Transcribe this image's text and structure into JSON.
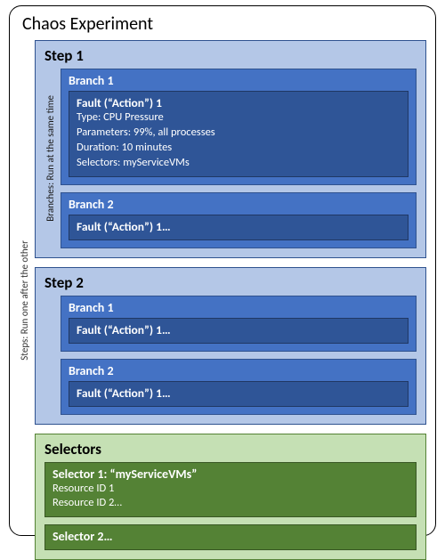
{
  "title": "Chaos Experiment",
  "labels": {
    "stepsSide": "Steps: Run one after the other",
    "branchesSide": "Branches: Run at the same time"
  },
  "steps": [
    {
      "title": "Step 1",
      "branches": [
        {
          "title": "Branch 1",
          "fault": {
            "title": "Fault (“Action”) 1",
            "lines": [
              "Type: CPU Pressure",
              "Parameters: 99%, all processes",
              "Duration: 10 minutes",
              "Selectors: myServiceVMs"
            ]
          }
        },
        {
          "title": "Branch 2",
          "fault": {
            "title": "Fault (“Action”) 1…",
            "lines": []
          }
        }
      ]
    },
    {
      "title": "Step 2",
      "branches": [
        {
          "title": "Branch 1",
          "fault": {
            "title": "Fault (“Action”) 1…",
            "lines": []
          }
        },
        {
          "title": "Branch 2",
          "fault": {
            "title": "Fault (“Action”) 1…",
            "lines": []
          }
        }
      ]
    }
  ],
  "selectorsSection": {
    "title": "Selectors",
    "selectors": [
      {
        "title": "Selector 1: “myServiceVMs”",
        "lines": [
          "Resource ID 1",
          "Resource ID 2…"
        ]
      },
      {
        "title": "Selector 2…",
        "lines": []
      }
    ]
  }
}
